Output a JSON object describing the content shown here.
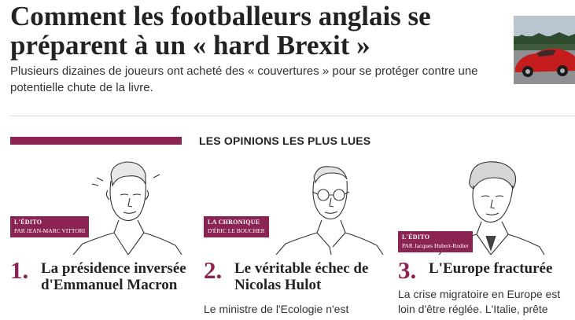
{
  "top_article": {
    "title": "Comment les footballeurs anglais se préparent à un « hard Brexit »",
    "summary": "Plusieurs dizaines de joueurs ont acheté des « couvertures » pour se protéger contre une potentielle chute de la livre.",
    "thumbnail_icon": "red-sports-car-photo"
  },
  "section": {
    "title": "LES OPINIONS LES PLUS LUES",
    "accent_color": "#8c2453"
  },
  "opinions": [
    {
      "rank": "1.",
      "tag_kind": "L'ÉDITO",
      "tag_author": "PAR JEAN-MARC VITTORI",
      "title": "La présidence inversée d'Emmanuel Macron",
      "excerpt": "",
      "portrait_icon": "columnist-sketch-portrait"
    },
    {
      "rank": "2.",
      "tag_kind": "LA CHRONIQUE",
      "tag_author": "D'ÉRIC LE BOUCHER",
      "title": "Le véritable échec de Nicolas Hulot",
      "excerpt": "Le ministre de l'Ecologie n'est",
      "portrait_icon": "columnist-sketch-portrait-glasses"
    },
    {
      "rank": "3.",
      "tag_kind": "L'ÉDITO",
      "tag_author": "PAR Jacques Hubert-Rodier",
      "title": "L'Europe fracturée",
      "excerpt": "La crise migratoire en Europe est loin d'être réglée. L'Italie, prête",
      "portrait_icon": "columnist-sketch-portrait-curly"
    }
  ]
}
